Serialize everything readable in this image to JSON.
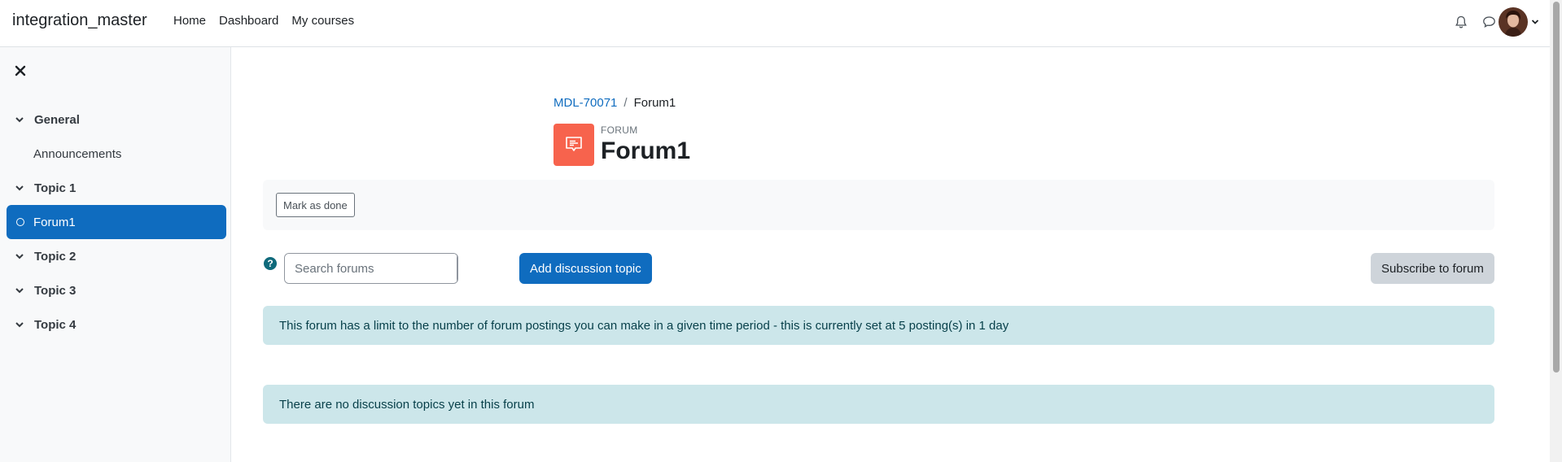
{
  "app": {
    "brand": "integration_master"
  },
  "primary_nav": [
    {
      "label": "Home"
    },
    {
      "label": "Dashboard"
    },
    {
      "label": "My courses"
    }
  ],
  "header_icons": {
    "notifications": "bell-icon",
    "messages": "chat-bubble-icon",
    "user_menu_caret": "chevron-down-icon"
  },
  "drawer": {
    "close_icon": "close-icon",
    "items": [
      {
        "type": "section",
        "label": "General"
      },
      {
        "type": "activity",
        "label": "Announcements"
      },
      {
        "type": "section",
        "label": "Topic 1"
      },
      {
        "type": "activity",
        "label": "Forum1",
        "active": true
      },
      {
        "type": "section",
        "label": "Topic 2"
      },
      {
        "type": "section",
        "label": "Topic 3"
      },
      {
        "type": "section",
        "label": "Topic 4"
      }
    ]
  },
  "breadcrumb": {
    "course": "MDL-70071",
    "separator": "/",
    "current": "Forum1"
  },
  "page_header": {
    "pretitle": "FORUM",
    "title": "Forum1",
    "icon": "forum-icon",
    "icon_color": "#f7634d"
  },
  "completion": {
    "mark_done_label": "Mark as done"
  },
  "toolbar": {
    "help_glyph": "?",
    "search_placeholder": "Search forums",
    "search_value": "",
    "add_topic_label": "Add discussion topic",
    "subscribe_label": "Subscribe to forum"
  },
  "alerts": {
    "limit_message": "This forum has a limit to the number of forum postings you can make in a given time period - this is currently set at 5 posting(s) in 1 day",
    "empty_message": "There are no discussion topics yet in this forum"
  },
  "colors": {
    "primary": "#0f6cbf",
    "info_bg": "#cce6ea",
    "info_text": "#063f49",
    "secondary_btn": "#ced4da"
  }
}
